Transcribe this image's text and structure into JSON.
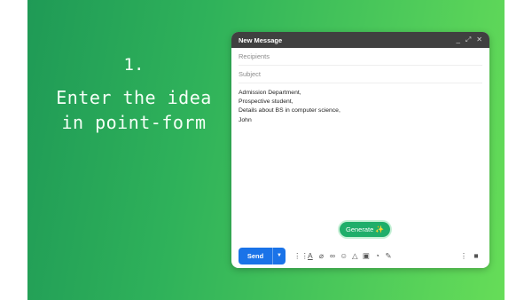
{
  "slide": {
    "step_number": "1.",
    "step_lines": [
      "Enter the idea",
      "in point-form"
    ]
  },
  "compose": {
    "title": "New Message",
    "window_controls": [
      "minimize-icon",
      "expand-icon",
      "close-icon"
    ],
    "recipients_placeholder": "Recipients",
    "subject_placeholder": "Subject",
    "body_lines": [
      "Admission Department,",
      "Prospective student,",
      "Details about BS in computer science,",
      "John"
    ],
    "generate_label": "Generate",
    "send_label": "Send",
    "toolbar_icons": [
      "formatting-options-icon",
      "text-color-icon",
      "attach-file-icon",
      "insert-link-icon",
      "emoji-icon",
      "drive-icon",
      "insert-photo-icon",
      "confidential-mode-icon",
      "signature-icon"
    ],
    "right_icons": [
      "more-options-icon",
      "discard-draft-icon"
    ]
  },
  "colors": {
    "gradient_start": "#1f9a56",
    "gradient_end": "#66dd58",
    "send_blue": "#1a73e8",
    "generate_green": "#1fae6a",
    "titlebar_gray": "#404040"
  }
}
